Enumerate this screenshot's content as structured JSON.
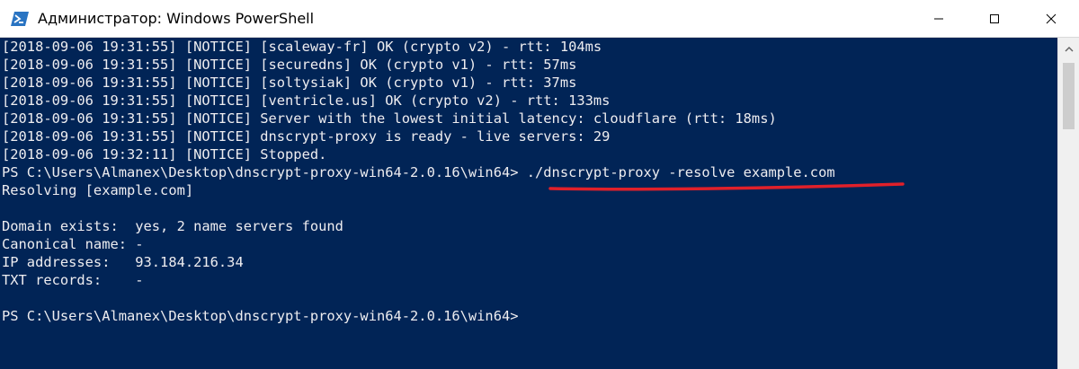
{
  "window": {
    "title": "Администратор: Windows PowerShell",
    "icon": "powershell-icon",
    "controls": [
      "minimize-icon",
      "maximize-icon",
      "close-icon"
    ]
  },
  "console": {
    "lines": [
      "[2018-09-06 19:31:55] [NOTICE] [scaleway-fr] OK (crypto v2) - rtt: 104ms",
      "[2018-09-06 19:31:55] [NOTICE] [securedns] OK (crypto v1) - rtt: 57ms",
      "[2018-09-06 19:31:55] [NOTICE] [soltysiak] OK (crypto v1) - rtt: 37ms",
      "[2018-09-06 19:31:55] [NOTICE] [ventricle.us] OK (crypto v2) - rtt: 133ms",
      "[2018-09-06 19:31:55] [NOTICE] Server with the lowest initial latency: cloudflare (rtt: 18ms)",
      "[2018-09-06 19:31:55] [NOTICE] dnscrypt-proxy is ready - live servers: 29",
      "[2018-09-06 19:32:11] [NOTICE] Stopped.",
      "PS C:\\Users\\Almanex\\Desktop\\dnscrypt-proxy-win64-2.0.16\\win64> ./dnscrypt-proxy -resolve example.com",
      "Resolving [example.com]",
      "",
      "Domain exists:  yes, 2 name servers found",
      "Canonical name: -",
      "IP addresses:   93.184.216.34",
      "TXT records:    -",
      "",
      "PS C:\\Users\\Almanex\\Desktop\\dnscrypt-proxy-win64-2.0.16\\win64>"
    ],
    "highlight_color": "#e0202a",
    "text_color": "#eeedf0",
    "background_color": "#012456"
  }
}
